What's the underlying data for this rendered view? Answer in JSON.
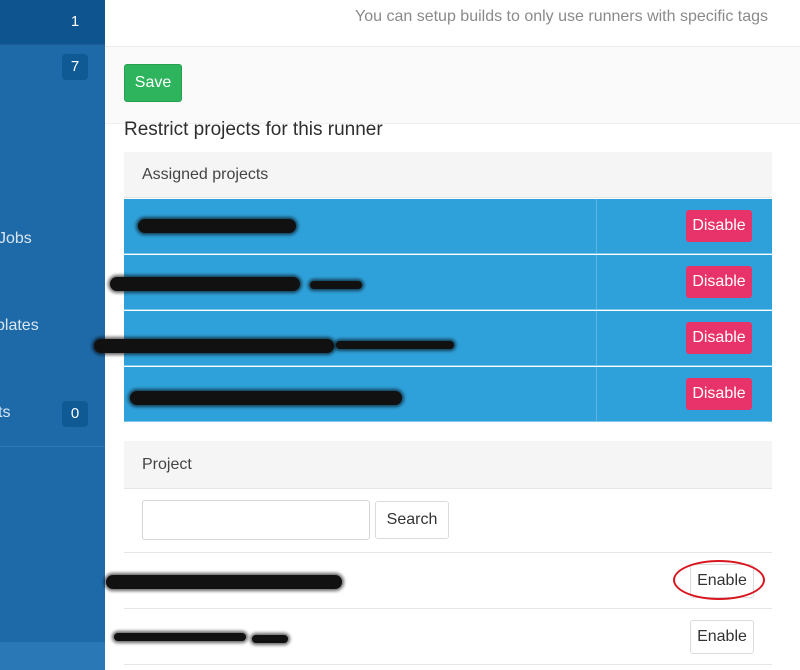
{
  "sidebar": {
    "rows": [
      {
        "label": "",
        "badge": "1"
      },
      {
        "label": "",
        "badge": "7"
      },
      {
        "label": "Jobs",
        "badge": ""
      },
      {
        "label": "plates",
        "badge": ""
      },
      {
        "label": "ts",
        "badge": "0"
      }
    ]
  },
  "help_text": "You can setup builds to only use runners with specific tags",
  "save_label": "Save",
  "section_title": "Restrict projects for this runner",
  "assigned": {
    "header": "Assigned projects",
    "button_label": "Disable"
  },
  "project": {
    "header": "Project",
    "search_button": "Search",
    "search_value": "",
    "button_label": "Enable"
  },
  "colors": {
    "sidebar": "#1e6aa8",
    "assigned_row": "#2fa1da",
    "disable_button": "#e8336a",
    "save_button": "#2eb45c",
    "highlight_ring": "#d9151d"
  }
}
